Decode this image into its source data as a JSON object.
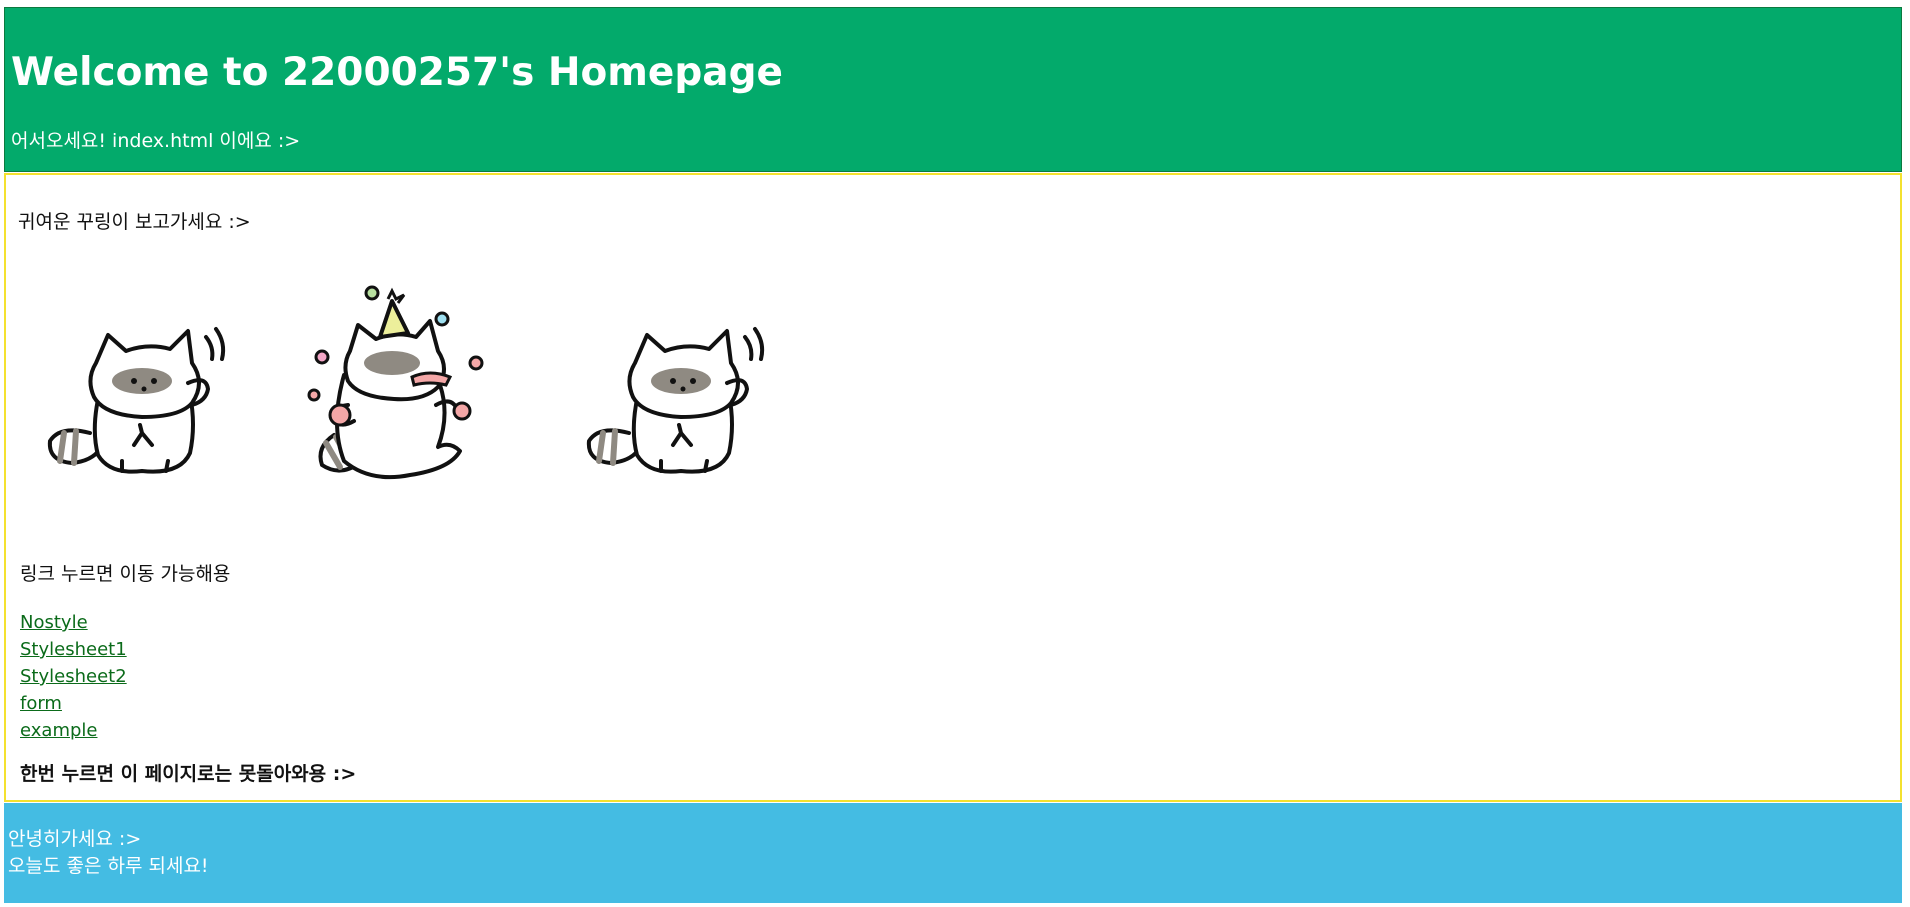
{
  "header": {
    "title": "Welcome to 22000257's Homepage",
    "subtitle": "어서오세요! index.html 이에요 :>",
    "background": "#03aa6b"
  },
  "main": {
    "intro": "귀여운 꾸링이 보고가세요 :>",
    "images": [
      {
        "icon": "raccoon-waving-icon"
      },
      {
        "icon": "raccoon-party-icon"
      },
      {
        "icon": "raccoon-waving-icon"
      }
    ],
    "links_caption": "링크 누르면 이동 가능해용",
    "links": [
      {
        "label": "Nostyle"
      },
      {
        "label": "Stylesheet1"
      },
      {
        "label": "Stylesheet2"
      },
      {
        "label": "form"
      },
      {
        "label": "example"
      }
    ],
    "warning": "한번 누르면 이 페이지로는 못돌아와용 :>",
    "border_color": "#f4e12f",
    "link_color": "#0b6b1a"
  },
  "footer": {
    "line1": "안녕히가세요 :>",
    "line2": "오늘도 좋은 하루 되세요!",
    "background": "#44bce3"
  }
}
